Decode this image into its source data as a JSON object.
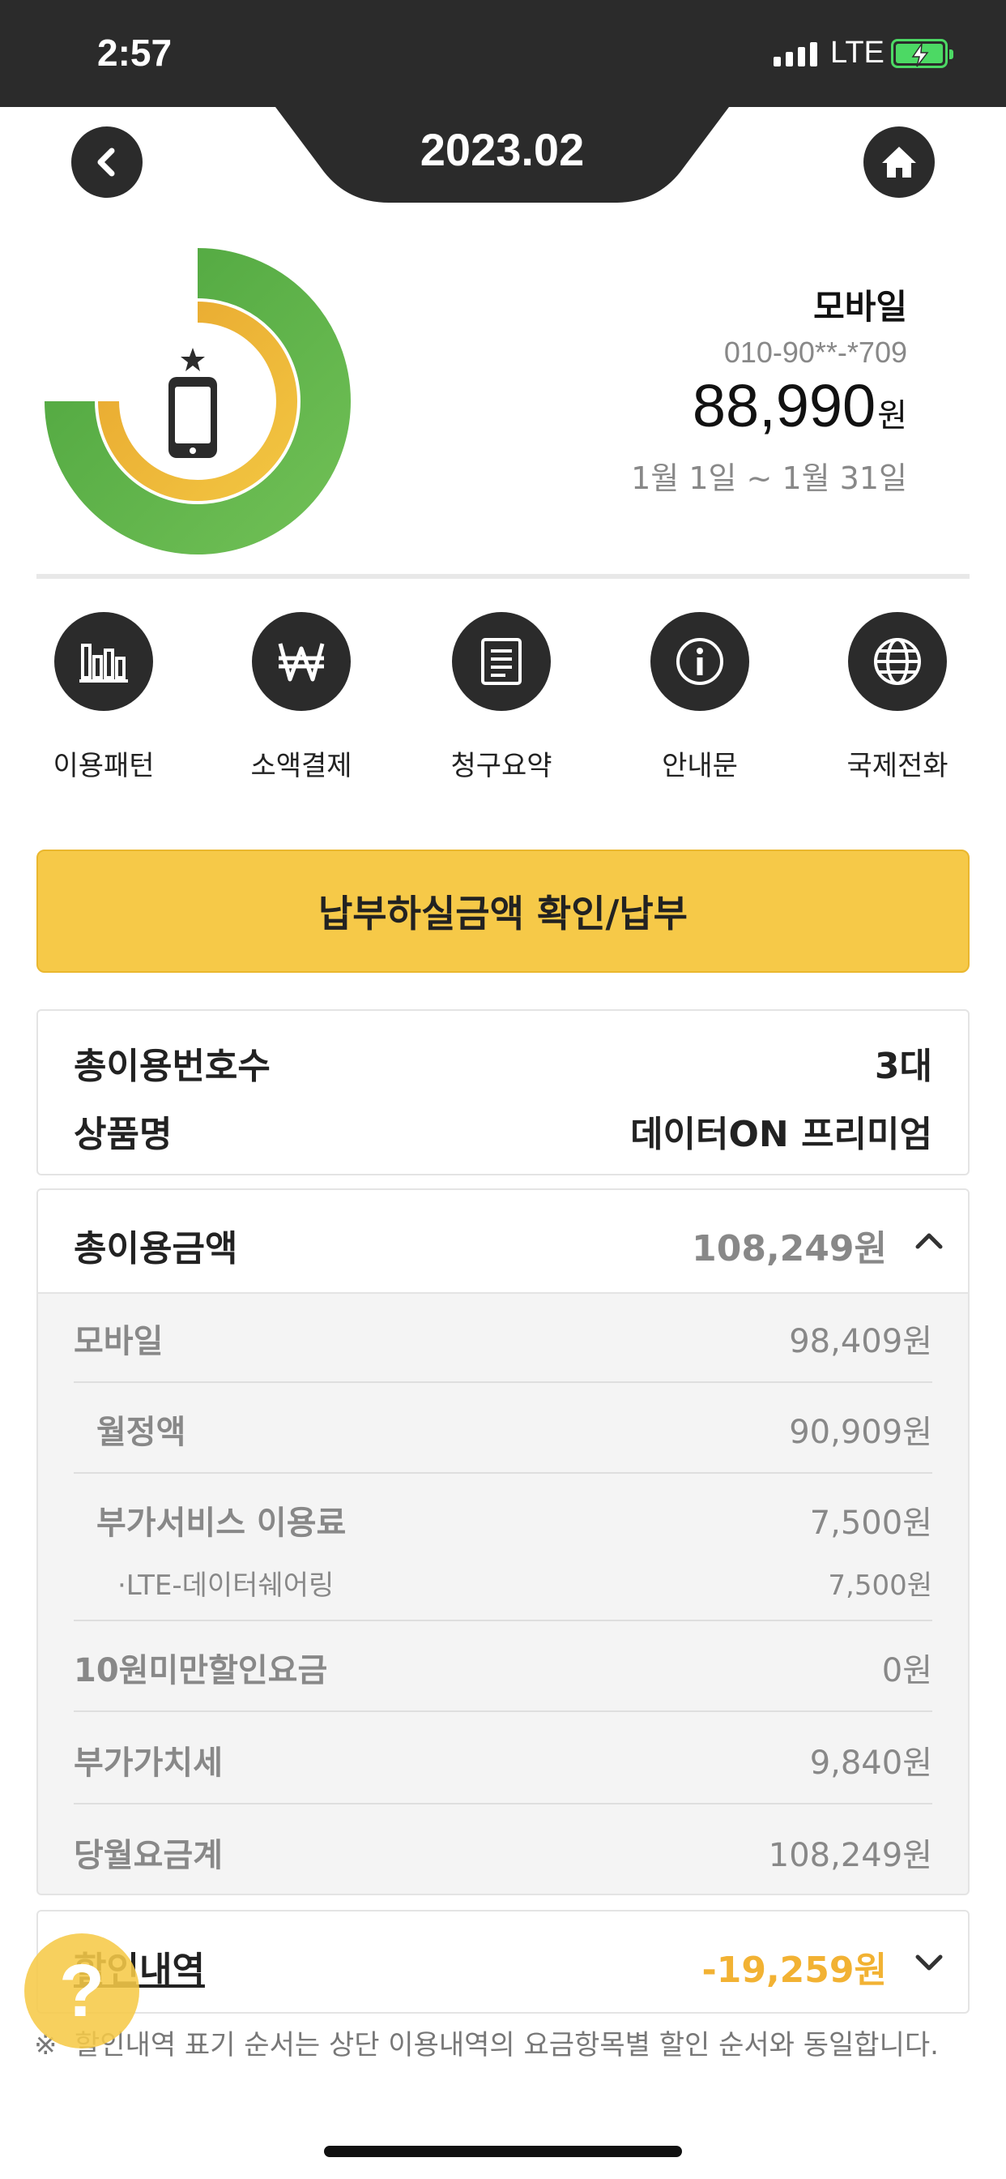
{
  "status_bar": {
    "time": "2:57",
    "network": "LTE"
  },
  "header": {
    "month": "2023.02"
  },
  "summary": {
    "kind": "모바일",
    "number": "010-90**-*709",
    "amount": "88,990",
    "unit": "원",
    "period": "1월 1일 ~ 1월 31일"
  },
  "quick_menu": [
    {
      "label": "이용패턴",
      "icon": "bar-chart-icon"
    },
    {
      "label": "소액결제",
      "icon": "won-icon"
    },
    {
      "label": "청구요약",
      "icon": "document-icon"
    },
    {
      "label": "안내문",
      "icon": "info-icon"
    },
    {
      "label": "국제전화",
      "icon": "globe-icon"
    }
  ],
  "pay_button": "납부하실금액 확인/납부",
  "info": {
    "lines_label": "총이용번호수",
    "lines_value": "3대",
    "product_label": "상품명",
    "product_value": "데이터ON 프리미엄"
  },
  "usage": {
    "title": "총이용금액",
    "total": "108,249원",
    "rows": [
      {
        "label": "모바일",
        "value": "98,409원"
      },
      {
        "label": "월정액",
        "value": "90,909원"
      },
      {
        "label": "부가서비스 이용료",
        "value": "7,500원"
      },
      {
        "label": "·LTE-데이터쉐어링",
        "value": "7,500원"
      },
      {
        "label": "10원미만할인요금",
        "value": "0원"
      },
      {
        "label": "부가가치세",
        "value": "9,840원"
      },
      {
        "label": "당월요금계",
        "value": "108,249원"
      }
    ]
  },
  "discount": {
    "title": "할인내역",
    "value": "-19,259원"
  },
  "note": {
    "mark": "※",
    "text": "할인내역 표기 순서는 상단 이용내역의 요금항목별 할인 순서와 동일합니다."
  },
  "help_symbol": "?",
  "colors": {
    "accent_yellow": "#f6c948",
    "dark": "#2b2b2b",
    "green": "#5db04a",
    "discount": "#f2b233"
  }
}
